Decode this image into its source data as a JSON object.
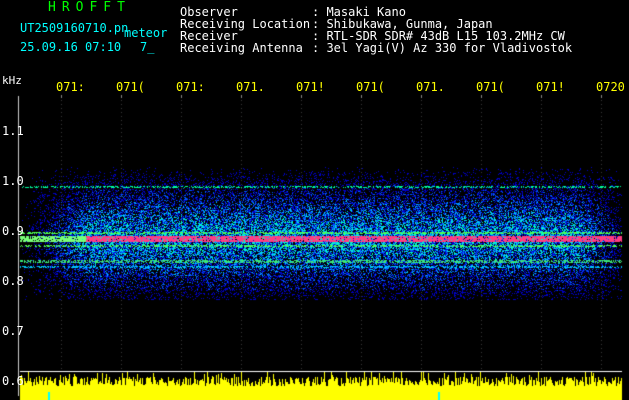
{
  "header": {
    "brand": "HROFFT",
    "filename": "UT2509160710.pn",
    "tag": "meteor",
    "date": "25.09.16 07:10",
    "count": "7_",
    "fields": [
      {
        "label": "Observer",
        "value": ": Masaki Kano"
      },
      {
        "label": "Receiving Location",
        "value": ": Shibukawa, Gunma, Japan"
      },
      {
        "label": "Receiver",
        "value": ": RTL-SDR SDR# 43dB L15 103.2MHz CW"
      },
      {
        "label": "Receiving Antenna",
        "value": ": 3el Yagi(V) Az 330 for Vladivostok"
      }
    ]
  },
  "axis": {
    "unit": "kHz",
    "y_ticks": [
      "1.1",
      "1.0",
      "0.9",
      "0.8",
      "0.7",
      "0.6"
    ],
    "x_ticks": [
      "071:",
      "071(",
      "071:",
      "071.",
      "071!",
      "071(",
      "071.",
      "071(",
      "071!",
      "0720"
    ]
  },
  "colors": {
    "background": "#000000",
    "brand": "#00ff00",
    "header_text": "#00ffff",
    "axis_labels": "#ffff00",
    "noise_low": "#0000cc",
    "noise_mid": "#00ffff",
    "echo_band": "#ff4488",
    "bottom_histogram": "#ffff00"
  }
}
